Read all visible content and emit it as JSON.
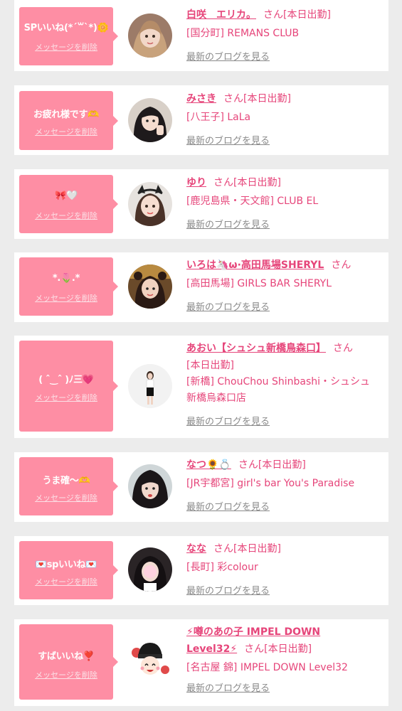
{
  "common": {
    "delete_label": "メッセージを削除",
    "blog_label": "最新のブログを見る",
    "san": "さん",
    "today": "[本日出勤]"
  },
  "colors": {
    "bubble": "#fe8ea4",
    "name": "#e6457a",
    "link": "#8a8a8a",
    "background": "#ececec"
  },
  "cards": [
    {
      "message": "SPいいね(*´꒳`*)🌼",
      "name": "白咲　エリカ。",
      "shop": "[国分町] REMANS CLUB",
      "today_inline": true
    },
    {
      "message": "お疲れ様です🫶",
      "name": "みさき",
      "shop": "[八王子] LaLa",
      "today_inline": true
    },
    {
      "message": "🎀🤍",
      "name": "ゆり",
      "shop": "[鹿児島県・天文館] CLUB EL",
      "today_inline": true
    },
    {
      "message": "*.🌷.*",
      "name": "いろは🦄ω·高田馬場SHERYL",
      "shop": "[高田馬場] GIRLS BAR SHERYL",
      "today_inline": false
    },
    {
      "message": "( ˆ‿ˆ )ﾉ三💗",
      "name": "あおい【シュシュ新橋鳥森口】",
      "shop_line1": "[新橋] ChouChou Shinbashi・シュシュ",
      "shop_line2": "新橋烏森口店",
      "today_inline": false
    },
    {
      "message": "うま確〜🫶",
      "name": "なつ🌻💍",
      "shop": "[JR宇都宮] girl's bar You's Paradise",
      "today_inline": true
    },
    {
      "message": "💌spいいね💌",
      "name": "なな",
      "shop": "[長町] 彩colour",
      "today_inline": true
    },
    {
      "message": "すばいいね❣️",
      "name_line1": "⚡噂のあの子 IMPEL DOWN",
      "name_line2": "Level32⚡",
      "shop": "[名古屋 錦] IMPEL DOWN Level32",
      "today_inline": true
    }
  ]
}
